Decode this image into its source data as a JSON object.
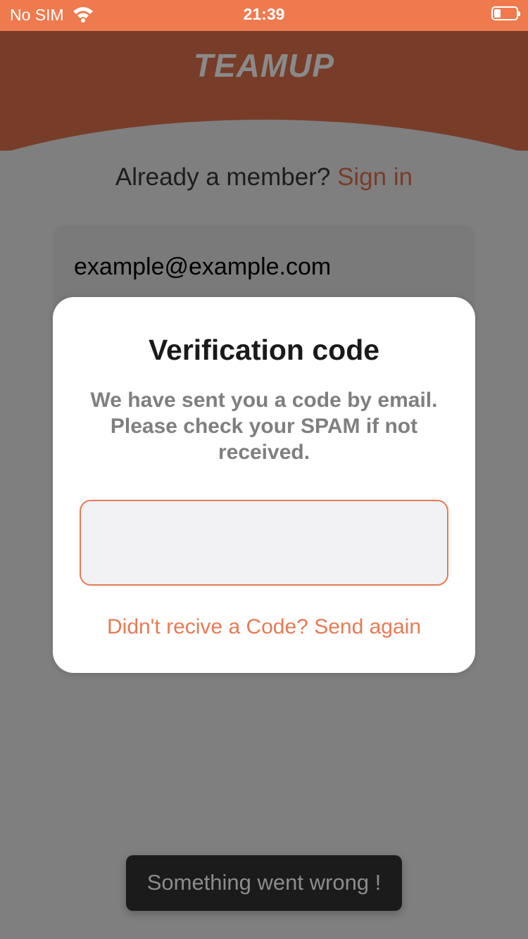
{
  "status_bar": {
    "carrier": "No SIM",
    "time": "21:39"
  },
  "header": {
    "logo_text": "TEAMUP"
  },
  "login_prompt": {
    "text": "Already a member?",
    "link": "Sign in"
  },
  "email_field": {
    "value": "example@example.com"
  },
  "modal": {
    "title": "Verification code",
    "message": "We have sent you a code by email. Please check your SPAM if not received.",
    "code_input": {
      "value": "",
      "placeholder": ""
    },
    "resend_link": "Didn't recive a Code? Send again"
  },
  "toast": {
    "text": "Something went wrong !"
  },
  "colors": {
    "accent": "#e87a53",
    "status_bar": "#ef7a4e",
    "header": "#773d29",
    "overlay": "#7f7f7f"
  }
}
